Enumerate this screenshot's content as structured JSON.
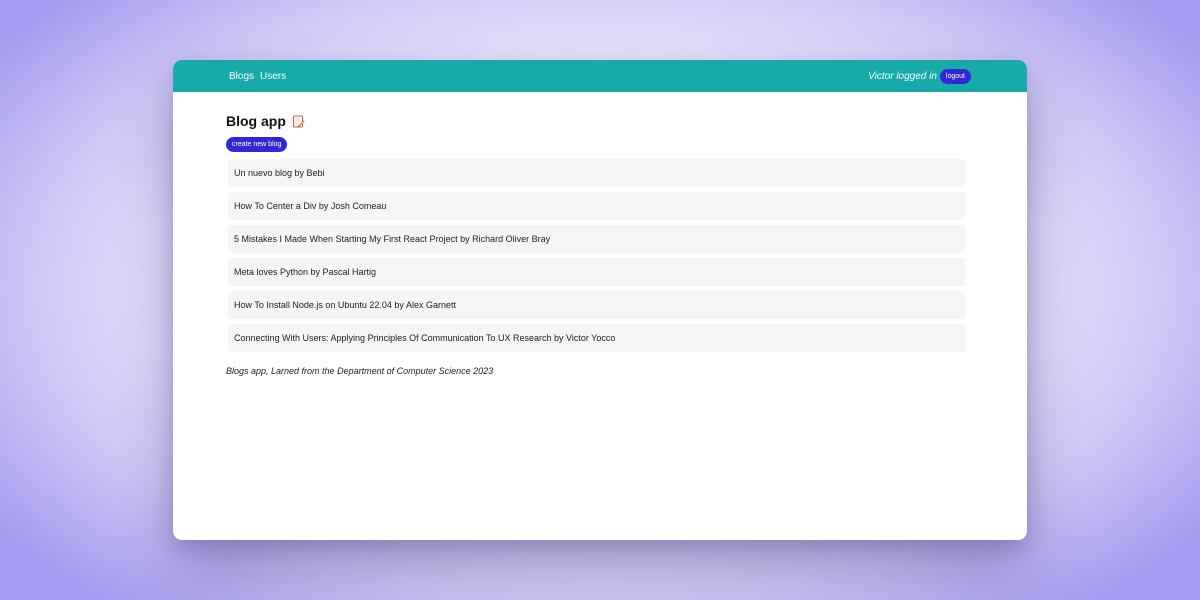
{
  "nav": {
    "links": [
      "Blogs",
      "Users"
    ],
    "logged_in_text": "Victor logged in",
    "logout_label": "logout"
  },
  "main": {
    "title": "Blog app",
    "title_icon": "memo-icon",
    "create_button_label": "create new blog",
    "blogs": [
      "Un nuevo blog by Bebi",
      "How To Center a Div by Josh Comeau",
      "5 Mistakes I Made When Starting My First React Project by Richard Oliver Bray",
      "Meta loves Python by Pascal Hartig",
      "How To Install Node.js on Ubuntu 22.04 by Alex Garnett",
      "Connecting With Users: Applying Principles Of Communication To UX Research by Victor Yocco"
    ]
  },
  "footer": {
    "text": "Blogs app, Larned from the Department of Computer Science 2023"
  },
  "colors": {
    "navbar": "#17aaa9",
    "button": "#3227d8",
    "item_background": "#f5f5f5"
  }
}
